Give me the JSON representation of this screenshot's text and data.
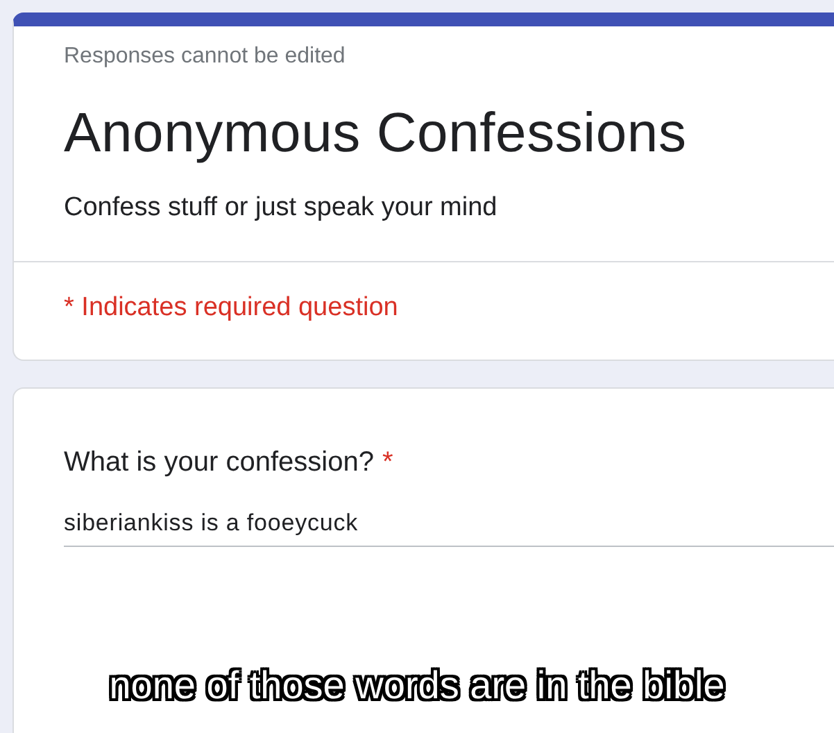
{
  "header_card": {
    "notice": "Responses cannot be edited",
    "title": "Anonymous Confessions",
    "description": "Confess stuff or just speak your mind",
    "required_note": "* Indicates required question"
  },
  "question": {
    "text": "What is your confession?",
    "required_mark": "*",
    "answer": "siberiankiss is a fooeycuck"
  },
  "caption": "none of those words are in the bible"
}
